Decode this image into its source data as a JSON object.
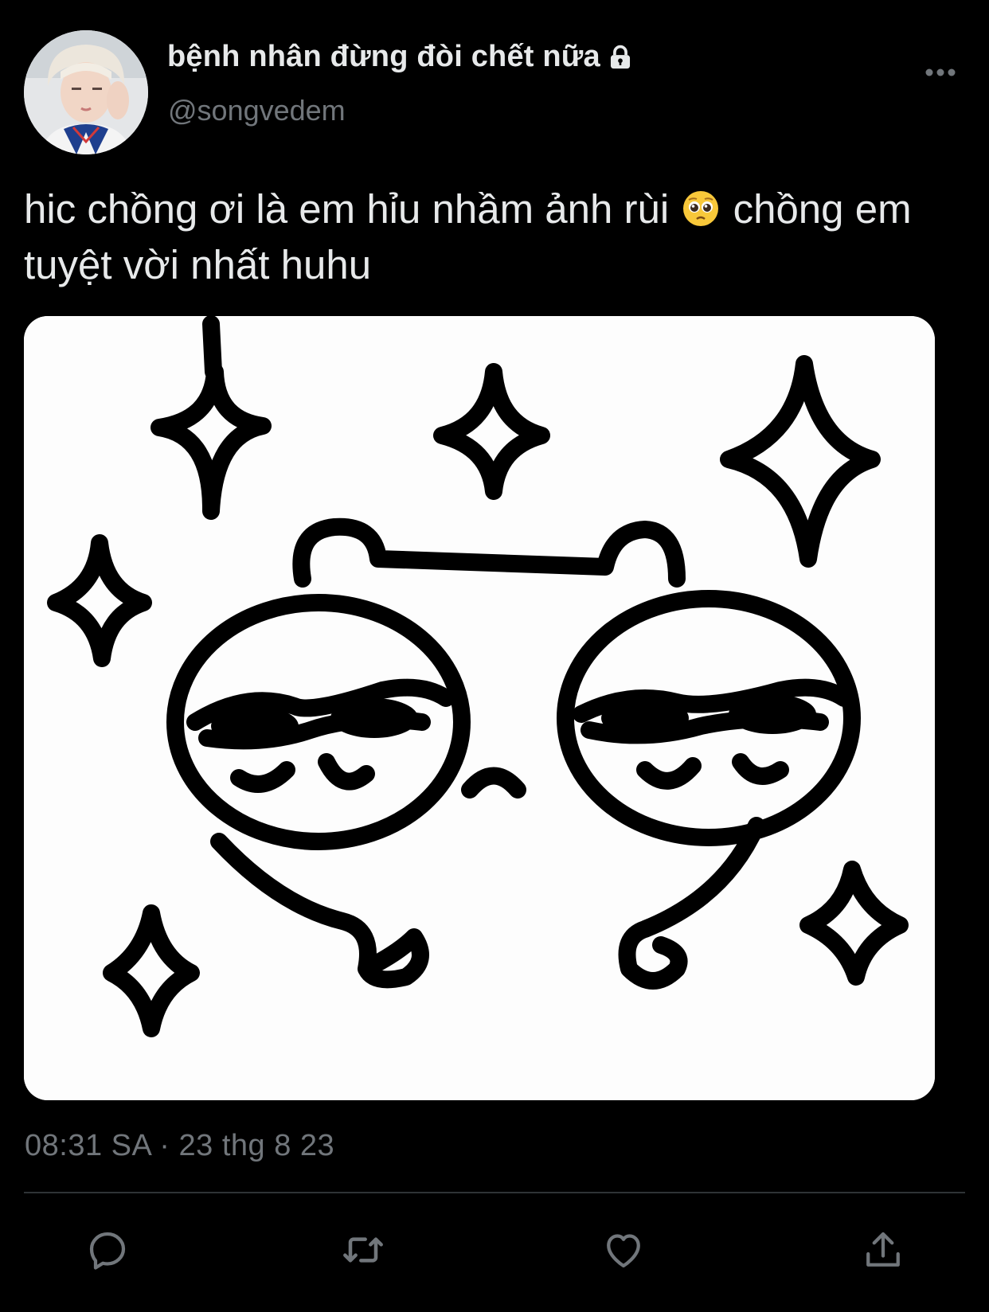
{
  "author": {
    "display_name": "bệnh nhân đừng đòi chết nữa",
    "handle": "@songvedem",
    "protected": true
  },
  "tweet": {
    "text_part1": "hic chồng ơi là em hỉu nhầm ảnh rùi",
    "emoji": "pleading-face",
    "text_part2": "chồng em tuyệt vời nhất huhu",
    "timestamp": "08:31 SA · 23 thg 8 23"
  },
  "actions": [
    "reply",
    "retweet",
    "like",
    "share"
  ],
  "colors": {
    "background": "#000000",
    "text": "#e7e9ea",
    "secondary": "#71767b",
    "divider": "#2f3336"
  }
}
